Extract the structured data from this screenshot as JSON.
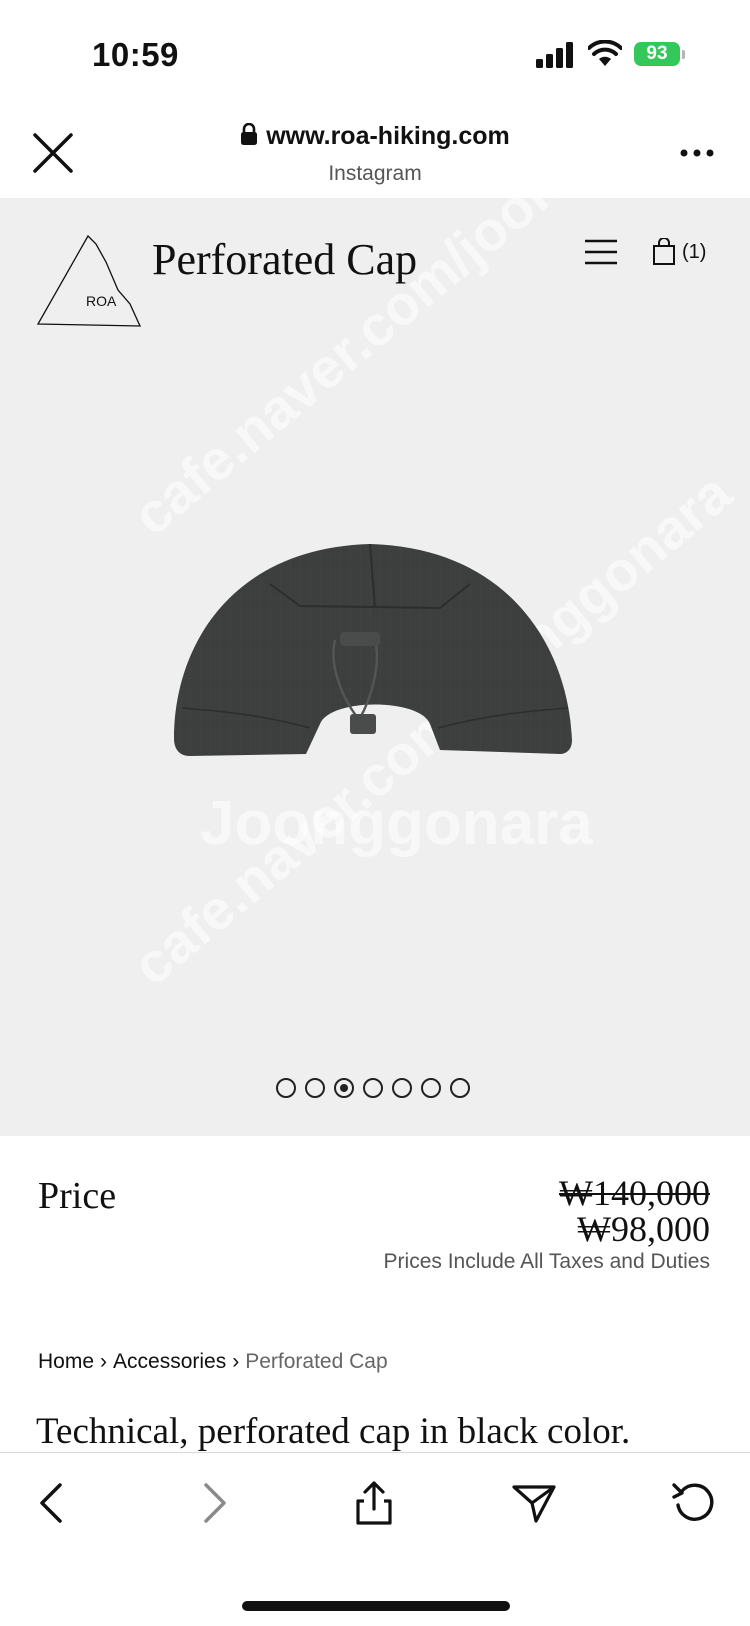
{
  "status_bar": {
    "time": "10:59",
    "battery": "93"
  },
  "browser": {
    "url": "www.roa-hiking.com",
    "source": "Instagram"
  },
  "site": {
    "logo_text": "ROA",
    "product_title": "Perforated Cap",
    "cart_count": "(1)"
  },
  "carousel": {
    "total": 7,
    "active_index": 2
  },
  "watermark": {
    "text_a": "cafe.naver.com/joonggonara",
    "text_b": "Joonggonara"
  },
  "price": {
    "label": "Price",
    "original": "₩140,000",
    "sale": "₩98,000",
    "note": "Prices Include All Taxes and Duties"
  },
  "breadcrumb": {
    "items": [
      "Home",
      "Accessories",
      "Perforated Cap"
    ],
    "separator": "›"
  },
  "description": {
    "text": "Technical, perforated cap in black color."
  },
  "colors": {
    "hero_bg": "#efefef",
    "battery_green": "#34c759",
    "text": "#111111"
  }
}
